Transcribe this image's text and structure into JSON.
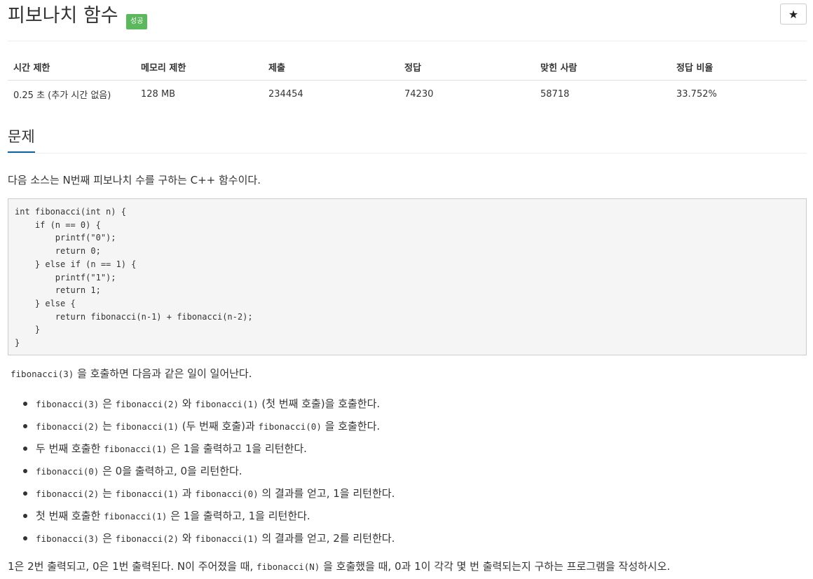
{
  "problem": {
    "title": "피보나치 함수",
    "badge": "성공",
    "star": "★"
  },
  "info_table": {
    "headers": [
      "시간 제한",
      "메모리 제한",
      "제출",
      "정답",
      "맞힌 사람",
      "정답 비율"
    ],
    "values": [
      "0.25 초 (추가 시간 없음)",
      "128 MB",
      "234454",
      "74230",
      "58718",
      "33.752%"
    ]
  },
  "section": {
    "title": "문제",
    "description": "다음 소스는 N번째 피보나치 수를 구하는 C++ 함수이다.",
    "code": "int fibonacci(int n) {\n    if (n == 0) {\n        printf(\"0\");\n        return 0;\n    } else if (n == 1) {\n        printf(\"1\");\n        return 1;\n    } else {\n        return fibonacci(n-1) + fibonacci(n-2);\n    }\n}",
    "intro": {
      "code": "fibonacci(3)",
      "text": " 을 호출하면 다음과 같은 일이 일어난다."
    },
    "steps": [
      [
        {
          "c": "fibonacci(3)"
        },
        {
          "t": " 은 "
        },
        {
          "c": "fibonacci(2)"
        },
        {
          "t": " 와 "
        },
        {
          "c": "fibonacci(1)"
        },
        {
          "t": " (첫 번째 호출)을 호출한다."
        }
      ],
      [
        {
          "c": "fibonacci(2)"
        },
        {
          "t": " 는 "
        },
        {
          "c": "fibonacci(1)"
        },
        {
          "t": " (두 번째 호출)과 "
        },
        {
          "c": "fibonacci(0)"
        },
        {
          "t": " 을 호출한다."
        }
      ],
      [
        {
          "t": "두 번째 호출한 "
        },
        {
          "c": "fibonacci(1)"
        },
        {
          "t": " 은 1을 출력하고 1을 리턴한다."
        }
      ],
      [
        {
          "c": "fibonacci(0)"
        },
        {
          "t": " 은 0을 출력하고, 0을 리턴한다."
        }
      ],
      [
        {
          "c": "fibonacci(2)"
        },
        {
          "t": " 는 "
        },
        {
          "c": "fibonacci(1)"
        },
        {
          "t": " 과 "
        },
        {
          "c": "fibonacci(0)"
        },
        {
          "t": " 의 결과를 얻고, 1을 리턴한다."
        }
      ],
      [
        {
          "t": "첫 번째 호출한 "
        },
        {
          "c": "fibonacci(1)"
        },
        {
          "t": " 은 1을 출력하고, 1을 리턴한다."
        }
      ],
      [
        {
          "c": "fibonacci(3)"
        },
        {
          "t": " 은 "
        },
        {
          "c": "fibonacci(2)"
        },
        {
          "t": " 와 "
        },
        {
          "c": "fibonacci(1)"
        },
        {
          "t": " 의 결과를 얻고, 2를 리턴한다."
        }
      ]
    ],
    "closing": {
      "before": "1은 2번 출력되고, 0은 1번 출력된다. N이 주어졌을 때, ",
      "code": "fibonacci(N)",
      "after": " 을 호출했을 때, 0과 1이 각각 몇 번 출력되는지 구하는 프로그램을 작성하시오."
    }
  },
  "colors": {
    "badge_bg": "#5cb85c",
    "section_underline": "#0b62a4",
    "code_bg": "#f5f5f5"
  }
}
